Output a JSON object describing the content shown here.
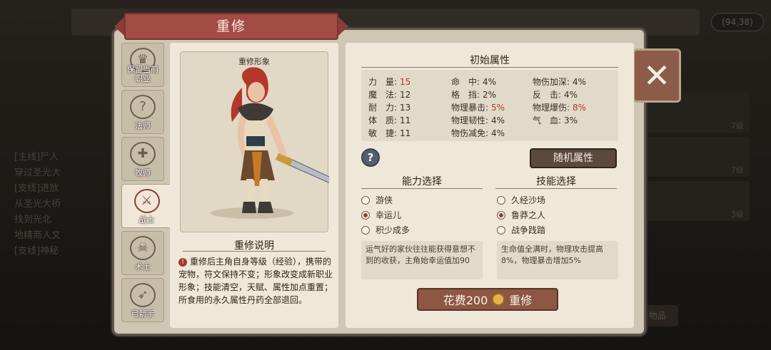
{
  "background": {
    "coord": "(94,38)",
    "quest_lines": [
      "[主线]尸人",
      "穿过圣光大",
      "[支线]进放",
      "从圣光大桥",
      "找到光北",
      "地精商人文",
      "[支线]神秘"
    ],
    "right_items": [
      "7级",
      "7级",
      "3级"
    ],
    "bottom_button": "务物品"
  },
  "dialog": {
    "title": "重修",
    "close_symbol": "✕"
  },
  "class_tabs": [
    {
      "label": "保留当前职业",
      "icon": "crest-icon",
      "active": false
    },
    {
      "label": "法师",
      "icon": "mage-icon",
      "active": false
    },
    {
      "label": "牧师",
      "icon": "priest-icon",
      "active": false
    },
    {
      "label": "战士",
      "icon": "warrior-icon",
      "active": true
    },
    {
      "label": "术士",
      "icon": "warlock-icon",
      "active": false
    },
    {
      "label": "弓箭手",
      "icon": "archer-icon",
      "active": false
    }
  ],
  "portrait": {
    "title": "重修形象"
  },
  "description": {
    "title": "重修说明",
    "text": "重修后主角自身等级（经验），携带的宠物，符文保持不变；形象改变成新职业形象；技能清空，天赋、属性加点重置；所食用的永久属性丹药全部退回。"
  },
  "attributes": {
    "title": "初始属性",
    "col1": [
      {
        "name": "力　量:",
        "value": "15",
        "highlight": true
      },
      {
        "name": "魔　法:",
        "value": "12",
        "highlight": false
      },
      {
        "name": "耐　力:",
        "value": "13",
        "highlight": false
      },
      {
        "name": "体　质:",
        "value": "11",
        "highlight": false
      },
      {
        "name": "敏　捷:",
        "value": "11",
        "highlight": false
      }
    ],
    "col2": [
      {
        "name": "命　中:",
        "value": "4%",
        "highlight": false
      },
      {
        "name": "格　挡:",
        "value": "2%",
        "highlight": false
      },
      {
        "name": "物理暴击:",
        "value": "5%",
        "highlight": true
      },
      {
        "name": "物理韧性:",
        "value": "4%",
        "highlight": false
      },
      {
        "name": "物伤减免:",
        "value": "4%",
        "highlight": false
      }
    ],
    "col3": [
      {
        "name": "物伤加深:",
        "value": "4%",
        "highlight": false
      },
      {
        "name": "反　击:",
        "value": "4%",
        "highlight": false
      },
      {
        "name": "物理爆伤:",
        "value": "8%",
        "highlight": true
      },
      {
        "name": "气　血:",
        "value": "3%",
        "highlight": false
      }
    ],
    "random_button": "随机属性",
    "help_symbol": "?"
  },
  "ability": {
    "title": "能力选择",
    "options": [
      {
        "label": "游侠",
        "selected": false
      },
      {
        "label": "幸运儿",
        "selected": true
      },
      {
        "label": "积少成多",
        "selected": false
      }
    ],
    "desc": "运气好的家伙往往能获得意想不到的收获，主角始幸运值加90"
  },
  "skill": {
    "title": "技能选择",
    "options": [
      {
        "label": "久经沙场",
        "selected": false
      },
      {
        "label": "鲁莽之人",
        "selected": true
      },
      {
        "label": "战争践踏",
        "selected": false
      }
    ],
    "desc": "生命值全满时，物理攻击提高8%，物理暴击增加5%"
  },
  "cost_button": {
    "prefix": "花费200",
    "suffix": "重修"
  },
  "colors": {
    "ribbon": "#a24c45",
    "accent_red": "#b03a32",
    "panel": "#cfc6b4",
    "paper": "#efe8d8"
  }
}
